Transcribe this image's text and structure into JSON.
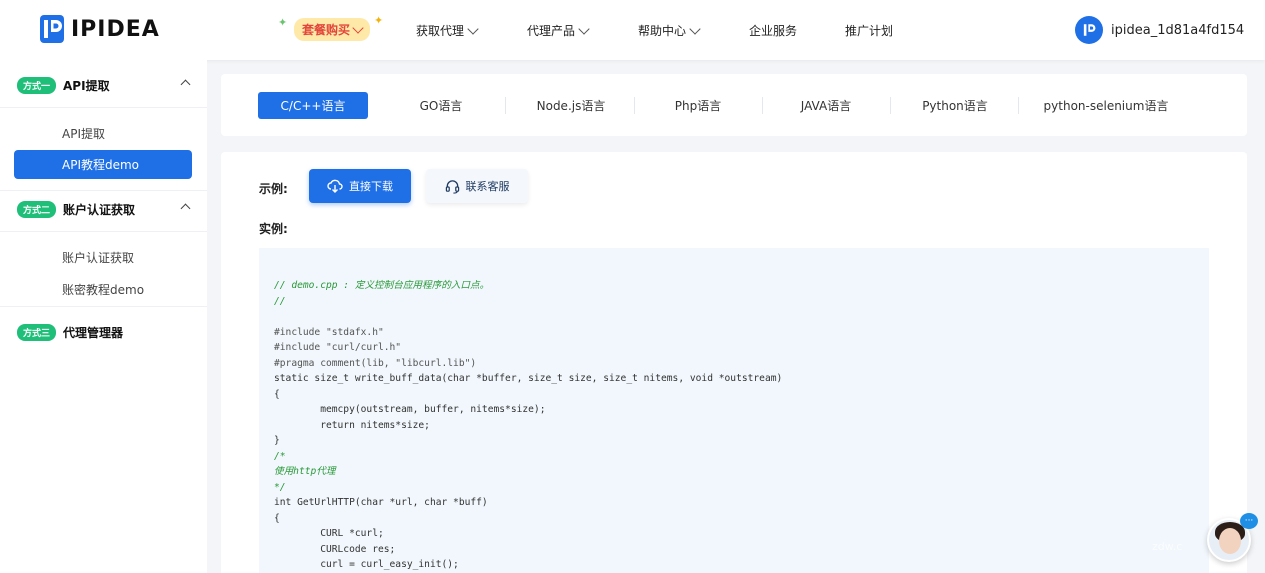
{
  "header": {
    "logo_text": "IPIDEA",
    "promo_label": "套餐购买",
    "nav": [
      {
        "label": "获取代理",
        "has_dropdown": true
      },
      {
        "label": "代理产品",
        "has_dropdown": true
      },
      {
        "label": "帮助中心",
        "has_dropdown": true
      },
      {
        "label": "企业服务",
        "has_dropdown": false
      },
      {
        "label": "推广计划",
        "has_dropdown": false
      }
    ],
    "username": "ipidea_1d81a4fd154",
    "brand_color": "#1f6fe6"
  },
  "sidebar": {
    "sections": [
      {
        "tag": "方式一",
        "title": "API提取",
        "expanded": true,
        "items": [
          {
            "label": "API提取",
            "active": false
          },
          {
            "label": "API教程demo",
            "active": true
          }
        ]
      },
      {
        "tag": "方式二",
        "title": "账户认证获取",
        "expanded": true,
        "items": [
          {
            "label": "账户认证获取",
            "active": false
          },
          {
            "label": "账密教程demo",
            "active": false
          }
        ]
      },
      {
        "tag": "方式三",
        "title": "代理管理器",
        "expanded": false,
        "items": []
      }
    ],
    "tag_color": "#1fbf7a"
  },
  "tabs": [
    {
      "label": "C/C++语言",
      "active": true
    },
    {
      "label": "GO语言",
      "active": false
    },
    {
      "label": "Node.js语言",
      "active": false
    },
    {
      "label": "Php语言",
      "active": false
    },
    {
      "label": "JAVA语言",
      "active": false
    },
    {
      "label": "Python语言",
      "active": false
    },
    {
      "label": "python-selenium语言",
      "active": false
    }
  ],
  "content": {
    "example_label": "示例:",
    "instance_label": "实例:",
    "download_button": "直接下载",
    "contact_button": "联系客服",
    "code_lines": [
      "// demo.cpp : 定义控制台应用程序的入口点。",
      "//",
      "",
      "#include \"stdafx.h\"",
      "#include \"curl/curl.h\"",
      "#pragma comment(lib, \"libcurl.lib\")",
      "static size_t write_buff_data(char *buffer, size_t size, size_t nitems, void *outstream)",
      "{",
      "        memcpy(outstream, buffer, nitems*size);",
      "        return nitems*size;",
      "}",
      "/*",
      "使用http代理",
      "*/",
      "int GetUrlHTTP(char *url, char *buff)",
      "{",
      "        CURL *curl;",
      "        CURLcode res;",
      "        curl = curl_easy_init();"
    ]
  },
  "chat_widget": {
    "badge": "···",
    "watermark": "zdw.c"
  }
}
